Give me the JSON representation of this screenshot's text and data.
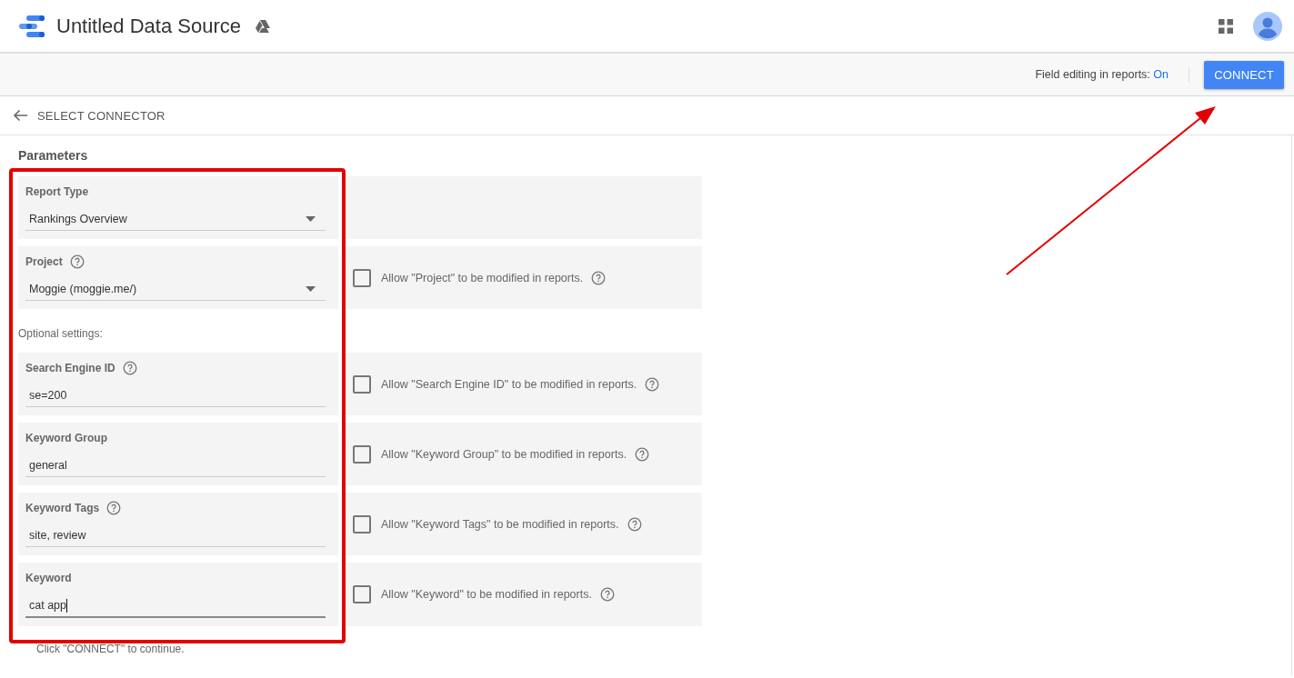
{
  "header": {
    "title": "Untitled Data Source"
  },
  "toolbar": {
    "field_editing_label": "Field editing in reports:",
    "field_editing_value": "On",
    "connect_button": "CONNECT"
  },
  "nav": {
    "back_label": "SELECT CONNECTOR"
  },
  "parameters": {
    "heading": "Parameters",
    "sections": [
      {
        "kind": "select",
        "label": "Report Type",
        "help": false,
        "value": "Rankings Overview",
        "focused": false
      },
      {
        "kind": "select",
        "label": "Project",
        "help": true,
        "value": "Moggie (moggie.me/)",
        "focused": false,
        "allow_label": "Allow \"Project\" to be modified in reports.",
        "allow_checked": false
      },
      {
        "kind": "note",
        "text": "Optional settings:"
      },
      {
        "kind": "text",
        "label": "Search Engine ID",
        "help": true,
        "value": "se=200",
        "focused": false,
        "allow_label": "Allow \"Search Engine ID\" to be modified in reports.",
        "allow_checked": false
      },
      {
        "kind": "text",
        "label": "Keyword Group",
        "help": false,
        "value": "general",
        "focused": false,
        "allow_label": "Allow \"Keyword Group\" to be modified in reports.",
        "allow_checked": false
      },
      {
        "kind": "text",
        "label": "Keyword Tags",
        "help": true,
        "value": "site, review",
        "focused": false,
        "allow_label": "Allow \"Keyword Tags\" to be modified in reports.",
        "allow_checked": false
      },
      {
        "kind": "text",
        "label": "Keyword",
        "help": false,
        "value": "cat app",
        "focused": true,
        "allow_label": "Allow \"Keyword\" to be modified in reports.",
        "allow_checked": false
      }
    ]
  },
  "footer_note": "Click \"CONNECT\" to continue."
}
